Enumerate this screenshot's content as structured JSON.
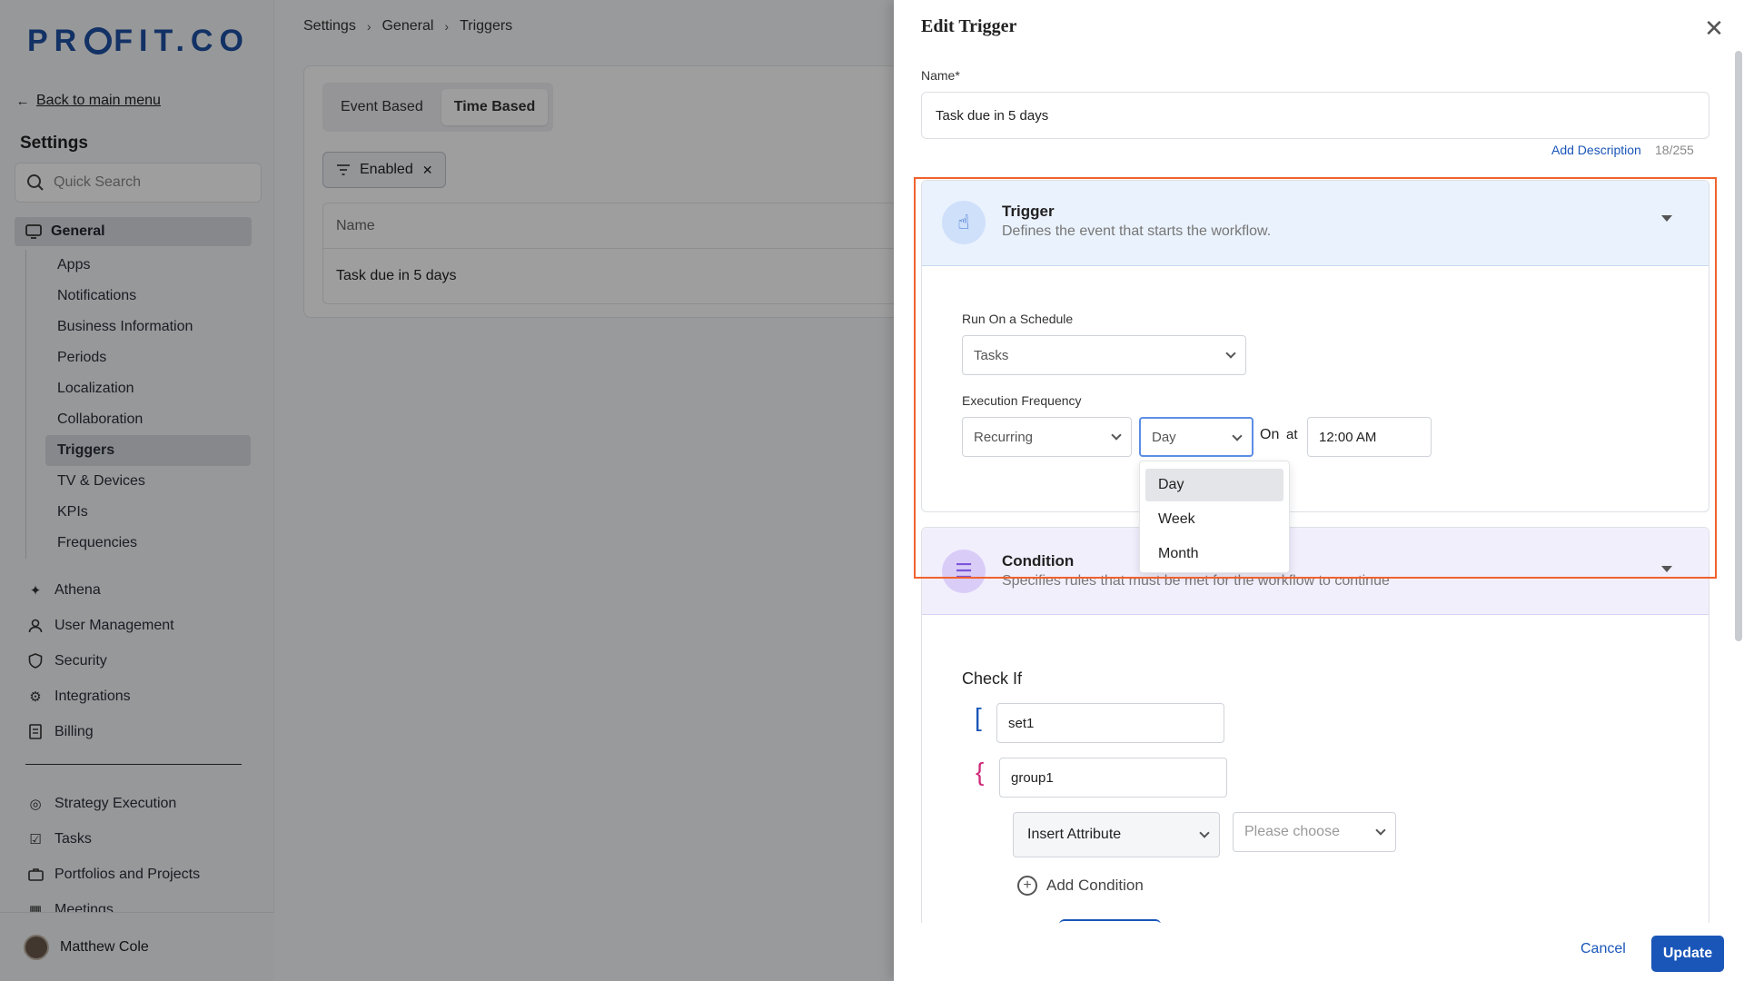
{
  "sidebar": {
    "logo": "PROFIT.CO",
    "back_label": "Back to main menu",
    "section_title": "Settings",
    "search_placeholder": "Quick Search",
    "general_label": "General",
    "sub_items": [
      "Apps",
      "Notifications",
      "Business Information",
      "Periods",
      "Localization",
      "Collaboration",
      "Triggers",
      "TV & Devices",
      "KPIs",
      "Frequencies"
    ],
    "active_sub_item": "Triggers",
    "main_items": [
      {
        "label": "Athena",
        "icon": "sparkle-icon"
      },
      {
        "label": "User Management",
        "icon": "user-icon"
      },
      {
        "label": "Security",
        "icon": "shield-icon"
      },
      {
        "label": "Integrations",
        "icon": "gear-icon"
      },
      {
        "label": "Billing",
        "icon": "receipt-icon"
      }
    ],
    "bottom_items": [
      {
        "label": "Strategy Execution",
        "icon": "target-icon"
      },
      {
        "label": "Tasks",
        "icon": "task-icon"
      },
      {
        "label": "Portfolios and Projects",
        "icon": "briefcase-icon"
      },
      {
        "label": "Meetings",
        "icon": "calendar-icon"
      }
    ],
    "user_name": "Matthew Cole"
  },
  "main": {
    "breadcrumb": [
      "Settings",
      "General",
      "Triggers"
    ],
    "tabs": [
      "Event Based",
      "Time Based"
    ],
    "active_tab": "Time Based",
    "filter_label": "Enabled",
    "table_header": "Name",
    "table_rows": [
      "Task due in 5 days"
    ]
  },
  "drawer": {
    "title": "Edit Trigger",
    "name_label": "Name*",
    "name_value": "Task due in 5 days",
    "add_description": "Add Description",
    "char_count": "18/255",
    "trigger": {
      "title": "Trigger",
      "subtitle": "Defines the event that starts the workflow.",
      "schedule_label": "Run On a Schedule",
      "schedule_value": "Tasks",
      "frequency_label": "Execution Frequency",
      "frequency_type": "Recurring",
      "frequency_unit": "Day",
      "on_label": "On",
      "at_label": "at",
      "time_value": "12:00 AM",
      "unit_options": [
        "Day",
        "Week",
        "Month"
      ],
      "selected_option": "Day"
    },
    "condition": {
      "title": "Condition",
      "subtitle": "Specifies rules that must be met for the workflow to continue",
      "check_if": "Check If",
      "set_name": "set1",
      "group_name": "group1",
      "attribute_select": "Insert Attribute",
      "choose_placeholder": "Please choose",
      "add_condition": "Add Condition"
    },
    "cancel_label": "Cancel",
    "update_label": "Update"
  },
  "colors": {
    "brand": "#1e4fa3",
    "link": "#1a56b8",
    "highlight": "#f0622d",
    "trigger_bg": "#eaf2fd",
    "condition_bg": "#f2effd"
  }
}
